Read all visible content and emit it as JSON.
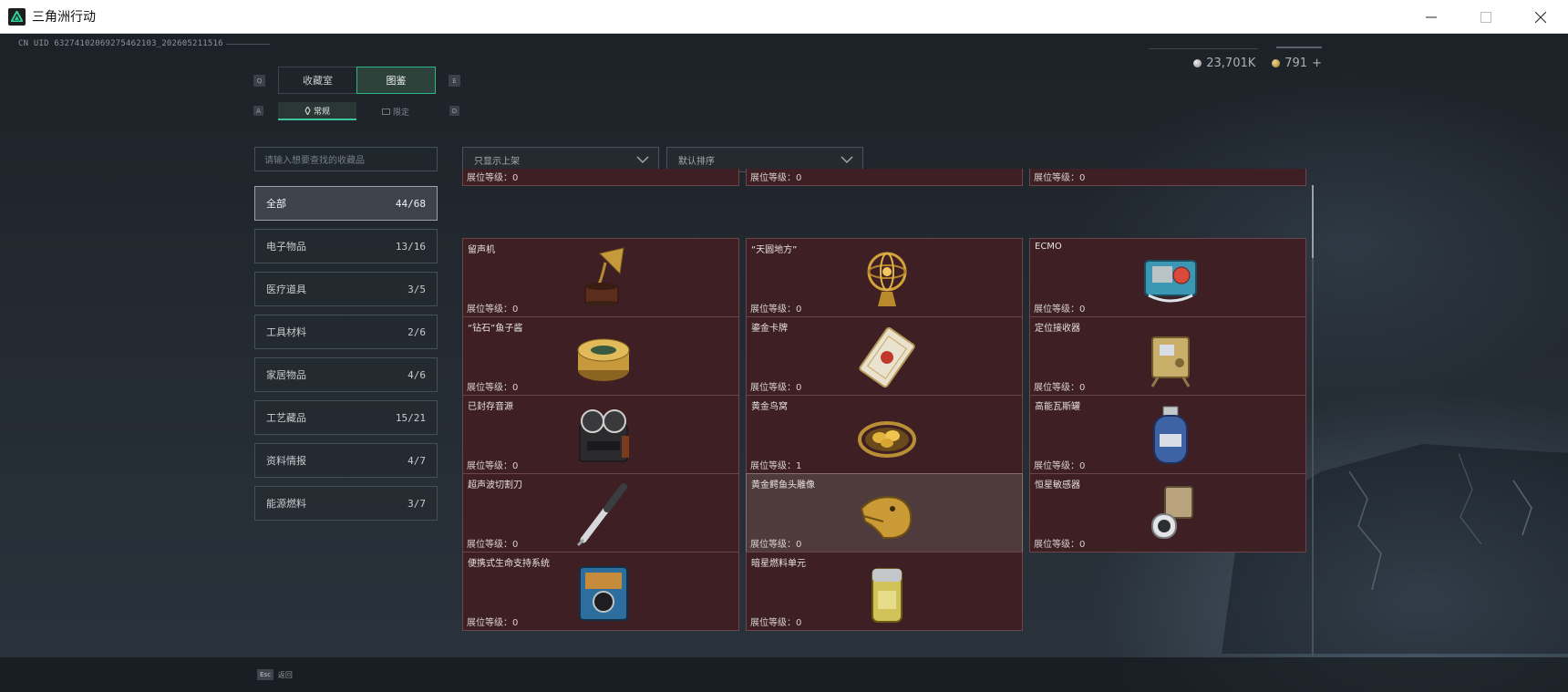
{
  "window": {
    "title": "三角洲行动",
    "controls": [
      "minimize",
      "maximize",
      "close"
    ]
  },
  "header": {
    "uid": "CN UID 6327410206927546​2103_202605211516",
    "silver_amount": "23,701K",
    "gold_amount": "791",
    "gold_add": "+"
  },
  "tabs": {
    "key_left": "Q",
    "key_right": "E",
    "items": [
      {
        "label": "收藏室",
        "active": false
      },
      {
        "label": "图鉴",
        "active": true
      }
    ]
  },
  "subtabs": {
    "key_left": "A",
    "key_right": "D",
    "items": [
      {
        "label": "常规",
        "active": true
      },
      {
        "label": "限定",
        "active": false
      }
    ]
  },
  "search": {
    "placeholder": "请输入想要查找的收藏品"
  },
  "categories": [
    {
      "label": "全部",
      "count": "44/68",
      "active": true
    },
    {
      "label": "电子物品",
      "count": "13/16",
      "active": false
    },
    {
      "label": "医疗道具",
      "count": "3/5",
      "active": false
    },
    {
      "label": "工具材料",
      "count": "2/6",
      "active": false
    },
    {
      "label": "家居物品",
      "count": "4/6",
      "active": false
    },
    {
      "label": "工艺藏品",
      "count": "15/21",
      "active": false
    },
    {
      "label": "资料情报",
      "count": "4/7",
      "active": false
    },
    {
      "label": "能源燃料",
      "count": "3/7",
      "active": false
    }
  ],
  "filters": {
    "show_filter": "只显示上架",
    "sort": "默认排序"
  },
  "level_label": "展位等级：",
  "items": [
    {
      "name": "",
      "level": "0",
      "icon": "item-partial-icon"
    },
    {
      "name": "",
      "level": "0",
      "icon": "item-partial-icon"
    },
    {
      "name": "",
      "level": "0",
      "icon": "item-partial-icon"
    },
    {
      "name": "留声机",
      "level": "0",
      "icon": "gramophone-icon"
    },
    {
      "name": "“天圆地方”",
      "level": "0",
      "icon": "armillary-sphere-icon"
    },
    {
      "name": "ECMO",
      "level": "0",
      "icon": "ecmo-machine-icon"
    },
    {
      "name": "“钻石”鱼子酱",
      "level": "0",
      "icon": "caviar-tin-icon"
    },
    {
      "name": "鎏金卡牌",
      "level": "0",
      "icon": "gilded-card-icon"
    },
    {
      "name": "定位接收器",
      "level": "0",
      "icon": "locator-receiver-icon"
    },
    {
      "name": "已封存音源",
      "level": "0",
      "icon": "reel-recorder-icon"
    },
    {
      "name": "黄金鸟窝",
      "level": "1",
      "icon": "golden-nest-icon"
    },
    {
      "name": "高能瓦斯罐",
      "level": "0",
      "icon": "gas-canister-icon"
    },
    {
      "name": "超声波切割刀",
      "level": "0",
      "icon": "ultrasonic-knife-icon"
    },
    {
      "name": "黄金鳄鱼头雕像",
      "level": "0",
      "icon": "gold-crocodile-head-icon"
    },
    {
      "name": "恒星敏感器",
      "level": "0",
      "icon": "star-sensor-icon"
    },
    {
      "name": "便携式生命支持系统",
      "level": "0",
      "icon": "life-support-icon"
    },
    {
      "name": "暗星燃料单元",
      "level": "0",
      "icon": "fuel-cell-icon"
    }
  ],
  "bottom": {
    "esc_key": "Esc",
    "back_label": "返回"
  },
  "colors": {
    "accent": "#2fb38a",
    "card_bg": "#3e1f24",
    "card_border": "#6b4549",
    "card_hover_bg": "#4f3b3c"
  }
}
